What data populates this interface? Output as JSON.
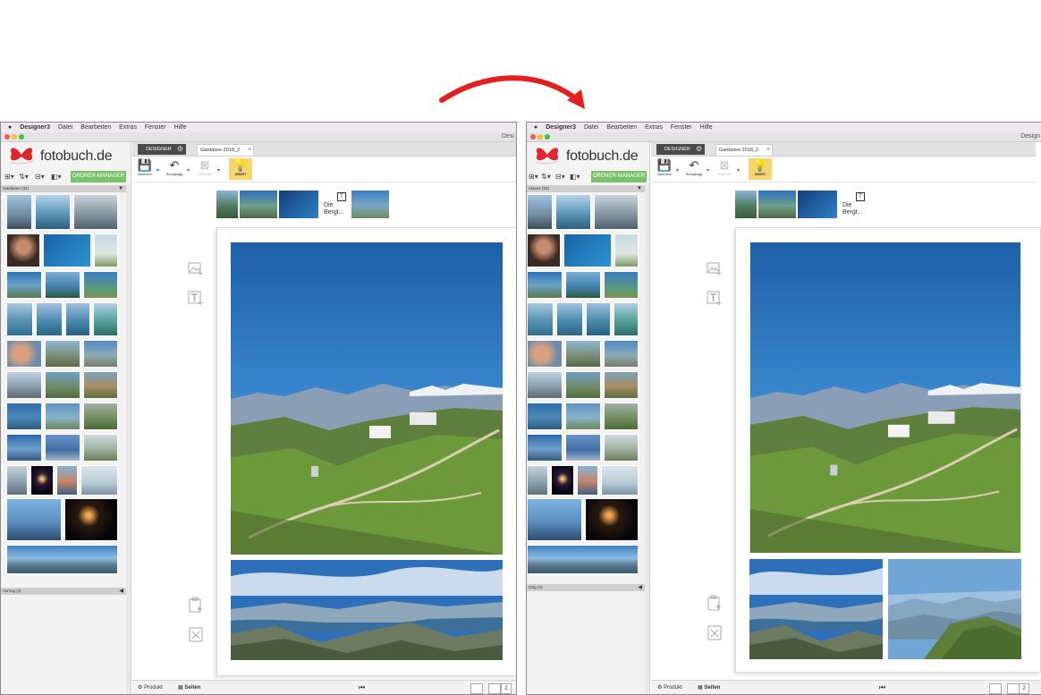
{
  "colors": {
    "accent_green": "#7cc06a",
    "smart_yellow": "#f6d56c",
    "annotation_red": "#e3201f",
    "designer_tab": "#4a4a4a"
  },
  "screens": [
    {
      "menubar": {
        "app": "Designer3",
        "items": [
          "Datei",
          "Bearbeiten",
          "Extras",
          "Fenster",
          "Hilfe"
        ]
      },
      "window_title": "Desi",
      "logo": {
        "main": "fotobuch",
        "suffix": ".de"
      },
      "sidebar": {
        "ordner_button": "ORDNER-MANAGER",
        "album_header": "Gardasee (32)",
        "second_header": "Vorzüg (3)"
      },
      "tabs": {
        "designer": "DESIGNER",
        "document": "Gardasee 2018_2"
      },
      "toolbar": {
        "save": "Speichern",
        "undo": "Rückgängig",
        "remove": "Entfernen",
        "smart": "SMART"
      },
      "strip_caption": [
        "Die",
        "Bergt..."
      ],
      "strip_t_icon": "T",
      "bottom": {
        "produkt": "Produkt",
        "seiten": "Seiten",
        "page_number": "2"
      }
    },
    {
      "menubar": {
        "app": "Designer3",
        "items": [
          "Datei",
          "Bearbeiten",
          "Extras",
          "Fenster",
          "Hilfe"
        ]
      },
      "window_title": "Design",
      "logo": {
        "main": "fotobuch",
        "suffix": ".de"
      },
      "sidebar": {
        "ordner_button": "ORDNER-MANAGER",
        "album_header": "rdasee (32)",
        "second_header": "rzüg (3)"
      },
      "tabs": {
        "designer": "DESIGNER",
        "document": "Gardasee 2018_2"
      },
      "toolbar": {
        "save": "Speichern",
        "undo": "Rückgängig",
        "remove": "Entfernen",
        "smart": "SMART"
      },
      "strip_caption": [
        "Die",
        "Bergt..."
      ],
      "strip_t_icon": "T",
      "bottom": {
        "produkt": "Produkt",
        "seiten": "Seiten",
        "page_number": "2"
      }
    }
  ]
}
